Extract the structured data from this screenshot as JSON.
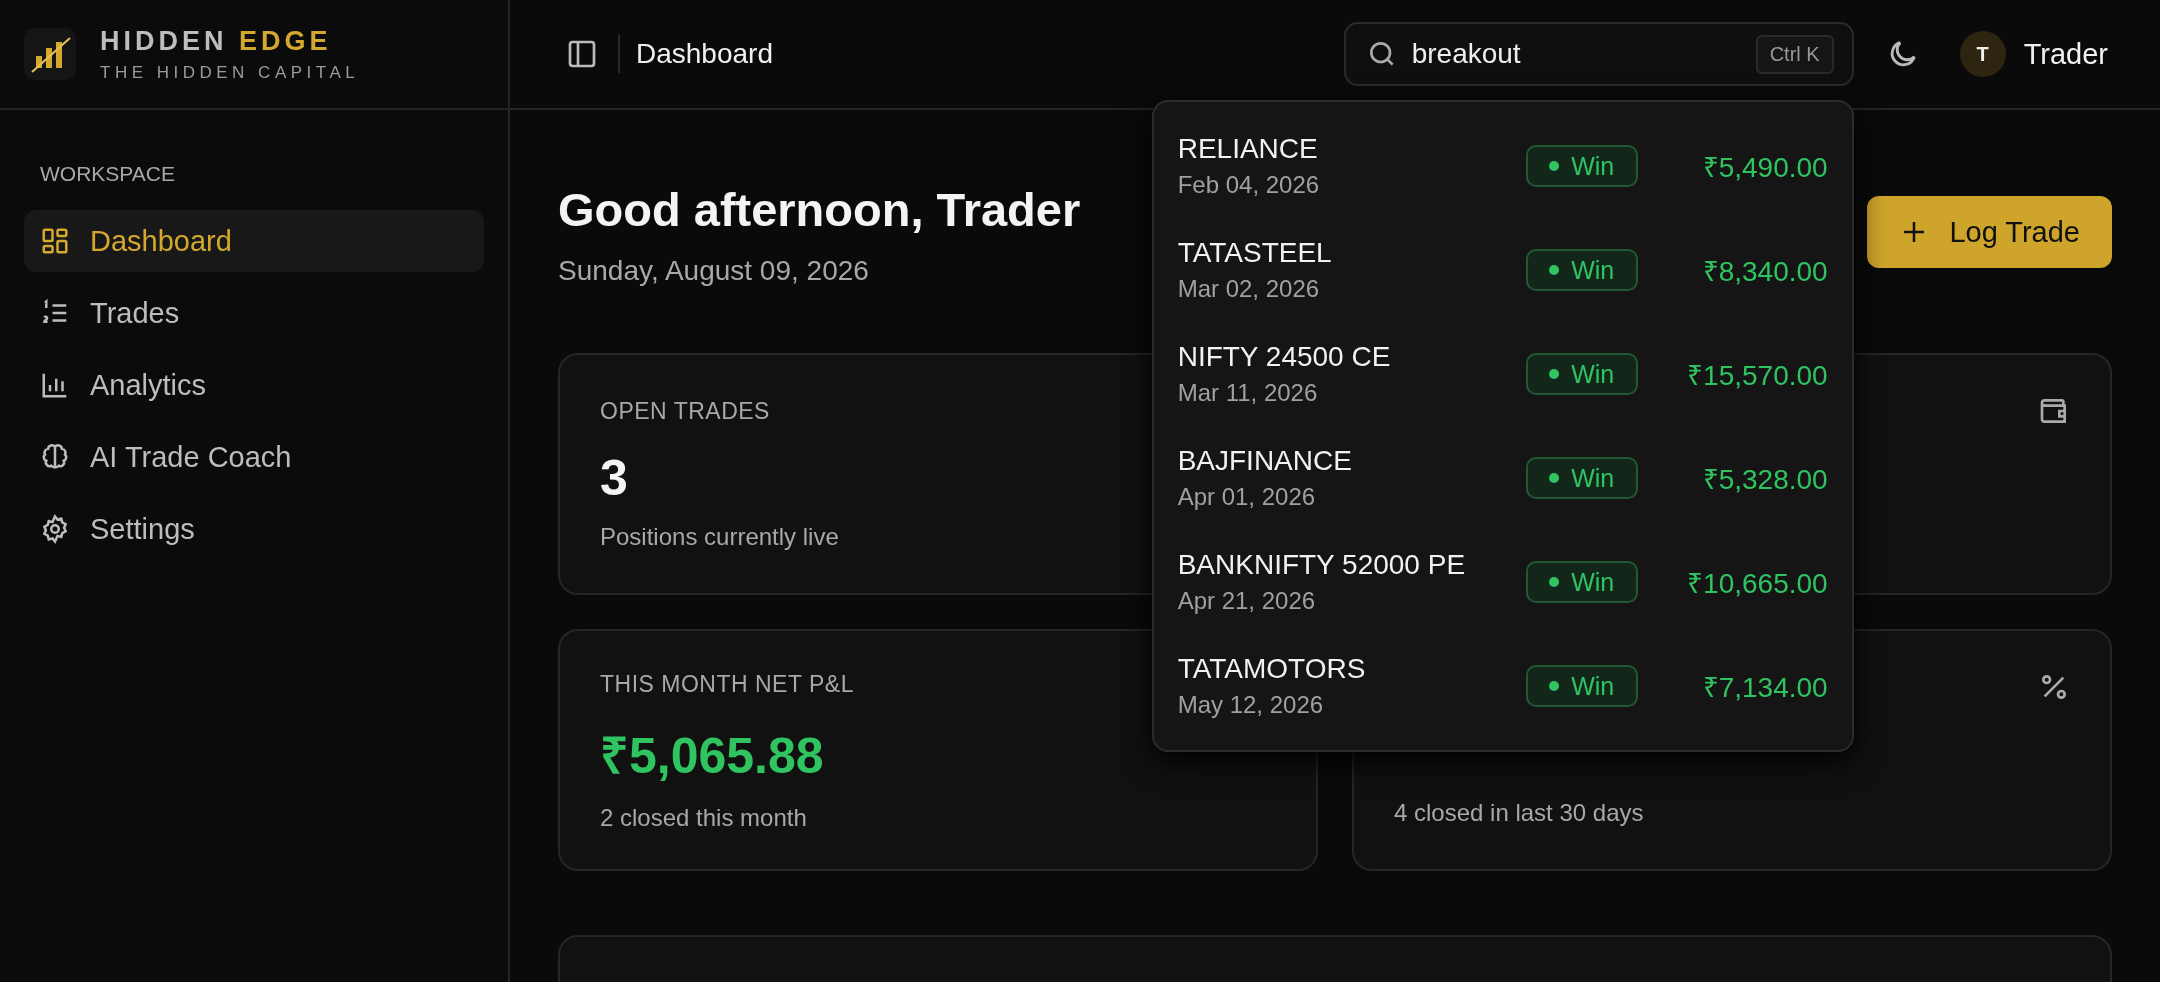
{
  "brand": {
    "name": "HIDDEN",
    "accent": "EDGE",
    "tagline": "THE HIDDEN CAPITAL"
  },
  "sidebar": {
    "section": "WORKSPACE",
    "items": [
      {
        "label": "Dashboard",
        "kind": "dashboard",
        "selected": true
      },
      {
        "label": "Trades",
        "kind": "list",
        "selected": false
      },
      {
        "label": "Analytics",
        "kind": "chart",
        "selected": false
      },
      {
        "label": "AI Trade Coach",
        "kind": "brain",
        "selected": false
      },
      {
        "label": "Settings",
        "kind": "settings",
        "selected": false
      }
    ]
  },
  "header": {
    "page_title": "Dashboard",
    "search": {
      "value": "breakout",
      "shortcut": "Ctrl K"
    },
    "user": {
      "initial": "T",
      "name": "Trader"
    }
  },
  "greeting": "Good afternoon, Trader",
  "date": "Sunday, August 09, 2026",
  "log_trade_button": "Log Trade",
  "stats": [
    {
      "title": "OPEN TRADES",
      "value": "3",
      "note": "Positions currently live",
      "color": "#f4f4f4"
    },
    {
      "kind": "wallet"
    },
    {
      "title": "THIS MONTH NET P&L",
      "value": "₹5,065.88",
      "note": "2 closed this month",
      "color": "#2fc460"
    },
    {
      "kind": "percent",
      "note": "4 closed in last 30 days"
    }
  ],
  "search_results": [
    {
      "symbol": "RELIANCE",
      "date": "Feb 04, 2026",
      "outcome": "Win",
      "amount": "₹5,490.00"
    },
    {
      "symbol": "TATASTEEL",
      "date": "Mar 02, 2026",
      "outcome": "Win",
      "amount": "₹8,340.00"
    },
    {
      "symbol": "NIFTY 24500 CE",
      "date": "Mar 11, 2026",
      "outcome": "Win",
      "amount": "₹15,570.00"
    },
    {
      "symbol": "BAJFINANCE",
      "date": "Apr 01, 2026",
      "outcome": "Win",
      "amount": "₹5,328.00"
    },
    {
      "symbol": "BANKNIFTY 52000 PE",
      "date": "Apr 21, 2026",
      "outcome": "Win",
      "amount": "₹10,665.00"
    },
    {
      "symbol": "TATAMOTORS",
      "date": "May 12, 2026",
      "outcome": "Win",
      "amount": "₹7,134.00"
    }
  ]
}
